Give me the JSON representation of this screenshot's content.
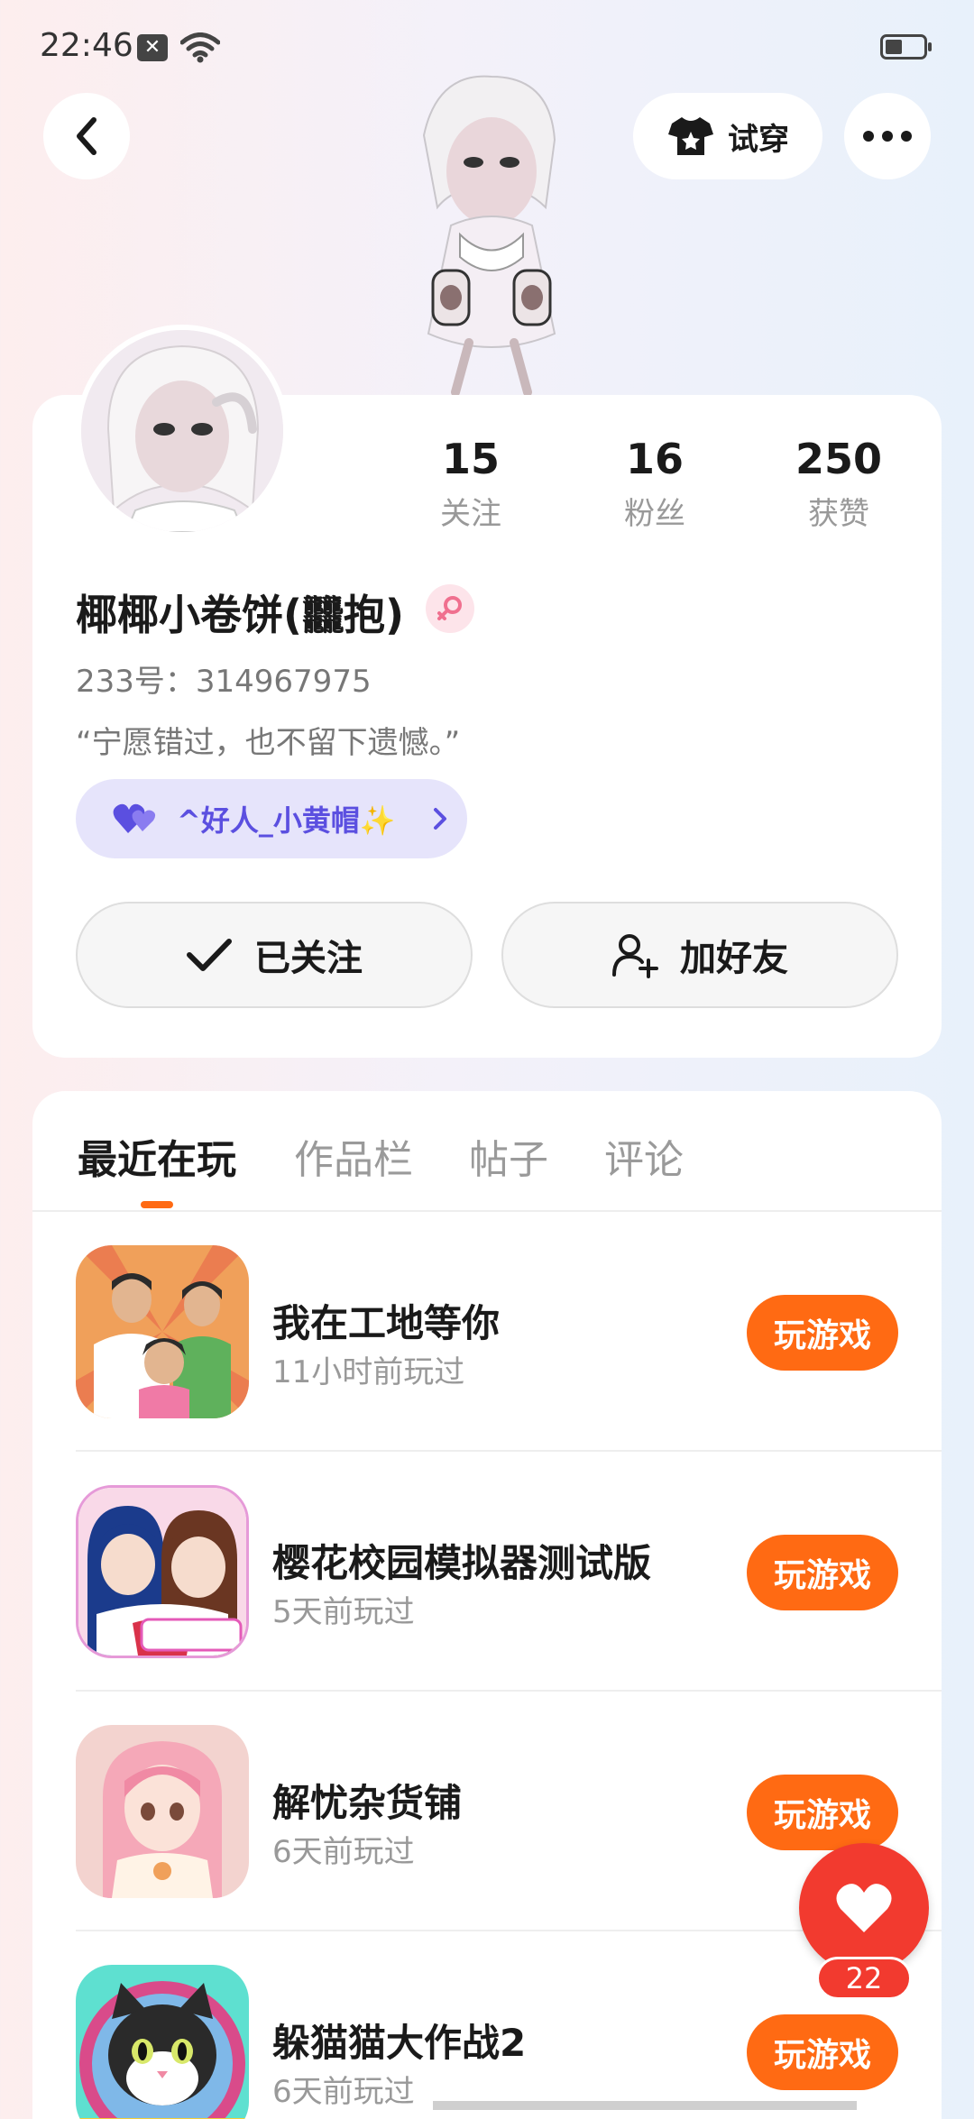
{
  "status_bar": {
    "time": "22:46",
    "notif_icon": "x-badge-icon",
    "wifi_icon": "wifi-icon",
    "battery_icon": "battery-icon"
  },
  "header": {
    "back_icon": "back-arrow-icon",
    "tryon_label": "试穿",
    "tryon_icon": "tshirt-icon",
    "more_icon": "more-dots-icon"
  },
  "profile": {
    "stats": [
      {
        "value": "15",
        "label": "关注"
      },
      {
        "value": "16",
        "label": "粉丝"
      },
      {
        "value": "250",
        "label": "获赞"
      }
    ],
    "nickname": "椰椰小卷饼(𪚥抱)",
    "uid": "233号：314967975",
    "bio": "“宁愿错过，也不留下遗憾。”",
    "tag": "^好人_小黄帽✨",
    "follow_label": "已关注",
    "add_friend_label": "加好友",
    "accent_color": "#5b4fe0"
  },
  "tabs": [
    "最近在玩",
    "作品栏",
    "帖子",
    "评论"
  ],
  "games": [
    {
      "title": "我在工地等你",
      "played": "11小时前玩过",
      "action": "玩游戏"
    },
    {
      "title": "樱花校园模拟器测试版",
      "played": "5天前玩过",
      "action": "玩游戏"
    },
    {
      "title": "解忧杂货铺",
      "played": "6天前玩过",
      "action": "玩游戏"
    },
    {
      "title": "躲猫猫大作战2",
      "played": "6天前玩过",
      "action": "玩游戏"
    }
  ],
  "like_fab": {
    "count": "22",
    "color": "#f23a2f"
  },
  "play_color": "#ff6a13"
}
